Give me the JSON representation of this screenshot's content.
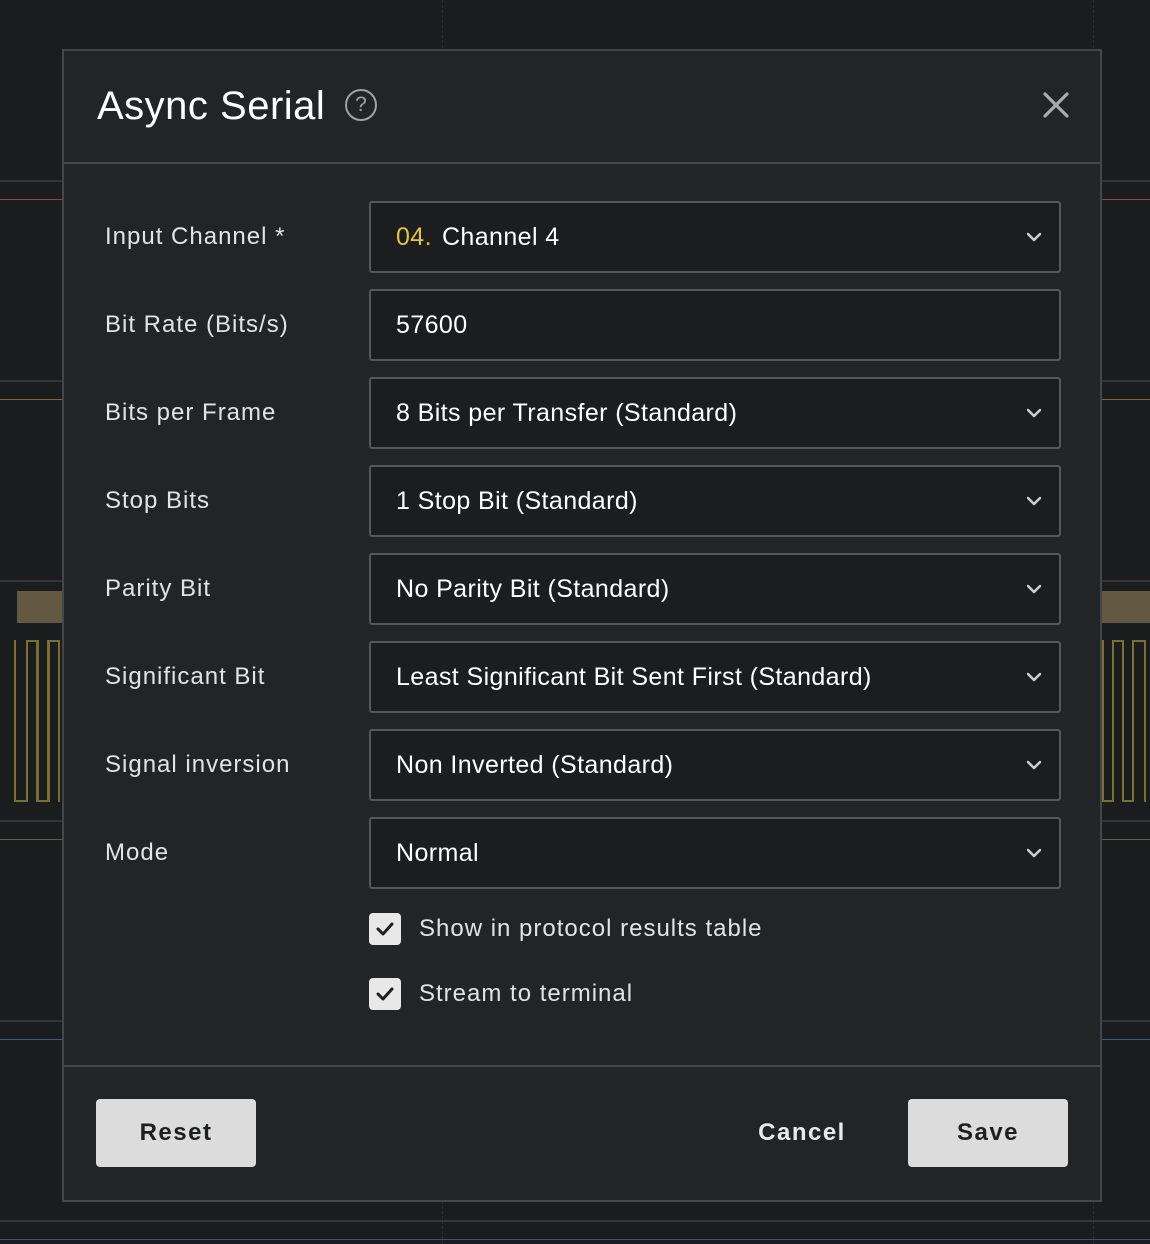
{
  "dialog": {
    "title": "Async Serial",
    "help_glyph": "?",
    "fields": [
      {
        "label": "Input Channel *",
        "channel_number": "04.",
        "value": "Channel 4",
        "type": "select"
      },
      {
        "label": "Bit Rate (Bits/s)",
        "value": "57600",
        "type": "input"
      },
      {
        "label": "Bits per Frame",
        "value": "8 Bits per Transfer (Standard)",
        "type": "select"
      },
      {
        "label": "Stop Bits",
        "value": "1 Stop Bit (Standard)",
        "type": "select"
      },
      {
        "label": "Parity Bit",
        "value": "No Parity Bit (Standard)",
        "type": "select"
      },
      {
        "label": "Significant Bit",
        "value": "Least Significant Bit Sent First (Standard)",
        "type": "select"
      },
      {
        "label": "Signal inversion",
        "value": "Non Inverted (Standard)",
        "type": "select"
      },
      {
        "label": "Mode",
        "value": "Normal",
        "type": "select"
      }
    ],
    "checkboxes": [
      {
        "label": "Show in protocol results table",
        "checked": true
      },
      {
        "label": "Stream to terminal",
        "checked": true
      }
    ],
    "footer": {
      "reset_label": "Reset",
      "cancel_label": "Cancel",
      "save_label": "Save"
    }
  },
  "colors": {
    "accent_channel": "#e6c43a",
    "dialog_bg": "#232426",
    "field_bg": "#1c1d1f",
    "button_bg": "#dcdcdc"
  },
  "icons": {
    "help": "help-circle-icon",
    "close": "close-icon",
    "dropdown": "chevron-down-icon",
    "check": "checkmark-icon"
  }
}
